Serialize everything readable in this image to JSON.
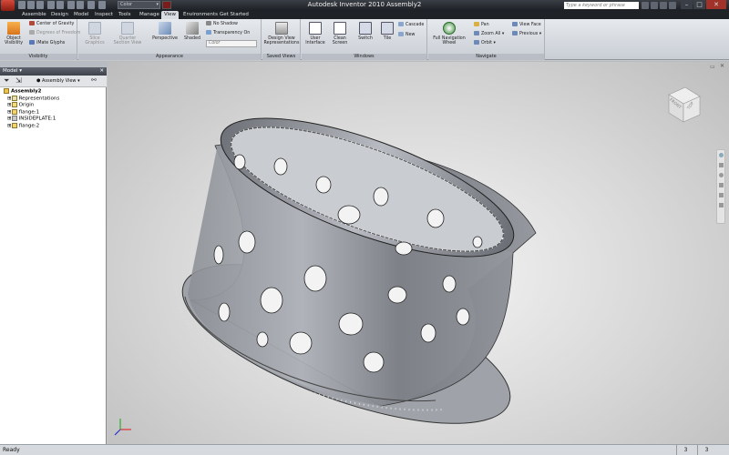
{
  "app": {
    "title": "Autodesk Inventor 2010    Assembly2",
    "search_placeholder": "Type a keyword or phrase",
    "qat_color": "Color"
  },
  "tabs": [
    "Assemble",
    "Design",
    "Model",
    "Inspect",
    "Tools",
    "Manage",
    "View",
    "Environments",
    "Get Started"
  ],
  "active_tab": "View",
  "ribbon": {
    "visibility": {
      "label": "Visibility",
      "object_visibility": "Object Visibility",
      "center_of_gravity": "Center of Gravity",
      "degrees_of_freedom": "Degrees of Freedom",
      "imate_glyphs": "iMate Glyphs"
    },
    "appearance": {
      "label": "Appearance",
      "slice_graphics": "Slice Graphics",
      "quarter_section_view": "Quarter Section View",
      "perspective": "Perspective",
      "shaded": "Shaded",
      "no_shadow": "No Shadow",
      "transparency_on": "Transparency On",
      "color": "Color"
    },
    "saved_views": {
      "label": "Saved Views",
      "design_view_representations": "Design View Representations"
    },
    "windows": {
      "label": "Windows",
      "user_interface": "User Interface",
      "clean_screen": "Clean Screen",
      "switch": "Switch",
      "tile": "Tile",
      "cascade": "Cascade",
      "new": "New"
    },
    "navigate": {
      "label": "Navigate",
      "full_navigation_wheel": "Full Navigation Wheel",
      "pan": "Pan",
      "zoom_all": "Zoom All",
      "orbit": "Orbit",
      "view_face": "View Face",
      "previous": "Previous"
    }
  },
  "browser": {
    "title": "Model",
    "view_dropdown": "Assembly View",
    "tree": [
      {
        "label": "Assembly2",
        "bold": true,
        "indent": 0
      },
      {
        "label": "Representations",
        "indent": 1
      },
      {
        "label": "Origin",
        "indent": 1
      },
      {
        "label": "flange:1",
        "indent": 1
      },
      {
        "label": "INSIDEPLATE:1",
        "indent": 1
      },
      {
        "label": "flange:2",
        "indent": 1
      }
    ]
  },
  "viewcube": {
    "front": "FRONT",
    "top": "TOP"
  },
  "status": {
    "text": "Ready",
    "count1": "3",
    "count2": "3"
  },
  "colors": {
    "titlebar": "#2a2e34",
    "ribbon": "#d9dde3",
    "part": "#9a9ea4"
  }
}
